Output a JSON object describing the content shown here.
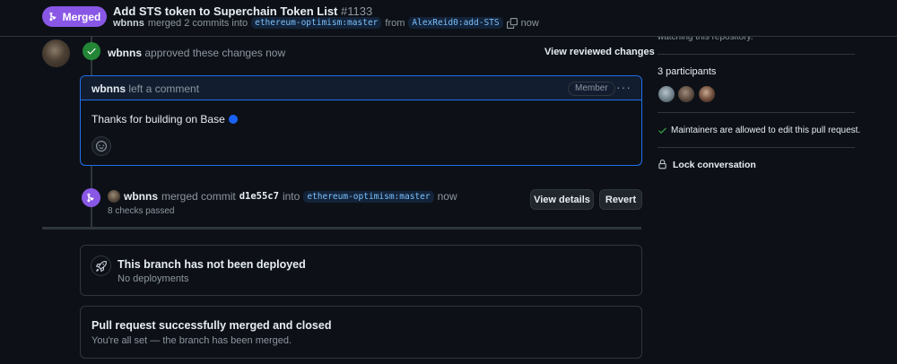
{
  "header": {
    "state_label": "Merged",
    "title": "Add STS token to Superchain Token List",
    "number": "#1133",
    "author": "wbnns",
    "merged_text": "merged 2 commits into",
    "base_branch": "ethereum-optimism:master",
    "from_text": "from",
    "head_branch": "AlexReid0:add-STS",
    "time": "now",
    "copy_icon": "copy-icon"
  },
  "review": {
    "user": "wbnns",
    "action": "approved these changes now",
    "view_label": "View reviewed changes"
  },
  "comment": {
    "user": "wbnns",
    "action": "left a comment",
    "role": "Member",
    "menu": "···",
    "body": "Thanks for building on Base",
    "body_emoji": "base-logo-icon"
  },
  "merge_event": {
    "user": "wbnns",
    "action": "merged commit",
    "sha": "d1e55c7",
    "into": "into",
    "branch": "ethereum-optimism:master",
    "time": "now",
    "checks": "8 checks passed",
    "view_details": "View details",
    "revert": "Revert"
  },
  "deploy_card": {
    "title": "This branch has not been deployed",
    "subtitle": "No deployments"
  },
  "merged_card": {
    "title": "Pull request successfully merged and closed",
    "subtitle": "You're all set — the branch has been merged."
  },
  "sidebar": {
    "watching_text": "watching this repository.",
    "participants_label": "3 participants",
    "maintainers_text": "Maintainers are allowed to edit this pull request.",
    "lock_label": "Lock conversation"
  },
  "colors": {
    "merged": "#8957e5",
    "approved": "#238636",
    "accent": "#1f6feb",
    "background": "#0d1117"
  }
}
